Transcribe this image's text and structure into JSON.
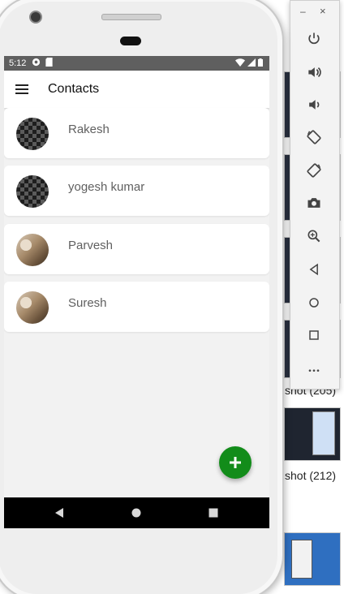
{
  "status_bar": {
    "time": "5:12"
  },
  "app_bar": {
    "title": "Contacts"
  },
  "contacts": [
    {
      "name": "Rakesh",
      "avatar": "checker"
    },
    {
      "name": "yogesh kumar",
      "avatar": "checker"
    },
    {
      "name": "Parvesh",
      "avatar": "photo"
    },
    {
      "name": "Suresh",
      "avatar": "photo"
    }
  ],
  "emulator_toolbar": {
    "minimize_label": "–",
    "close_label": "×",
    "buttons": [
      "power-icon",
      "volume-up-icon",
      "volume-down-icon",
      "rotate-left-icon",
      "rotate-right-icon",
      "camera-icon",
      "zoom-icon",
      "back-icon",
      "home-icon",
      "overview-icon",
      "more-icon"
    ]
  },
  "background_files": {
    "labels": [
      "shot (205)",
      "shot (212)"
    ]
  },
  "colors": {
    "fab": "#128c1a",
    "status_bar": "#5f5f5f",
    "nav_bar": "#000000"
  }
}
